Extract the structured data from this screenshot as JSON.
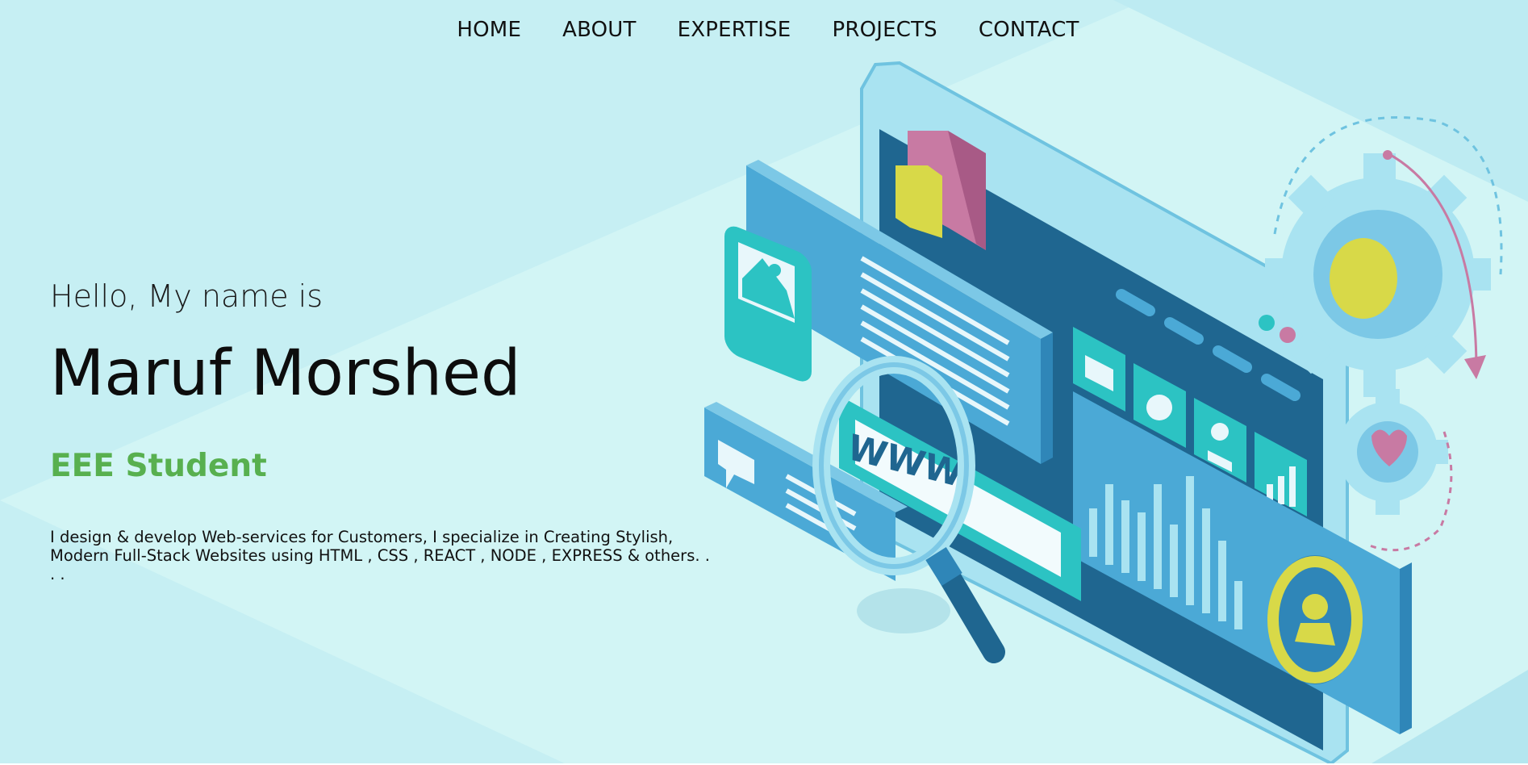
{
  "nav": {
    "items": [
      {
        "label": "HOME"
      },
      {
        "label": "ABOUT"
      },
      {
        "label": "EXPERTISE"
      },
      {
        "label": "PROJECTS"
      },
      {
        "label": "CONTACT"
      }
    ]
  },
  "hero": {
    "greeting": "Hello, My name is",
    "name": "Maruf Morshed",
    "role": "EEE Student",
    "description": "I design & develop Web-services for Customers, I specialize in Creating Stylish, Modern Full-Stack Websites using HTML , CSS , REACT , NODE , EXPRESS & others. . . ."
  },
  "illustration": {
    "search_text": "WWW"
  },
  "colors": {
    "background": "#c6eff3",
    "accent_green": "#58b04f",
    "screen_dark": "#1f6690",
    "teal": "#2cc3c3",
    "pink": "#c87aa3",
    "yellow": "#d8d948"
  }
}
